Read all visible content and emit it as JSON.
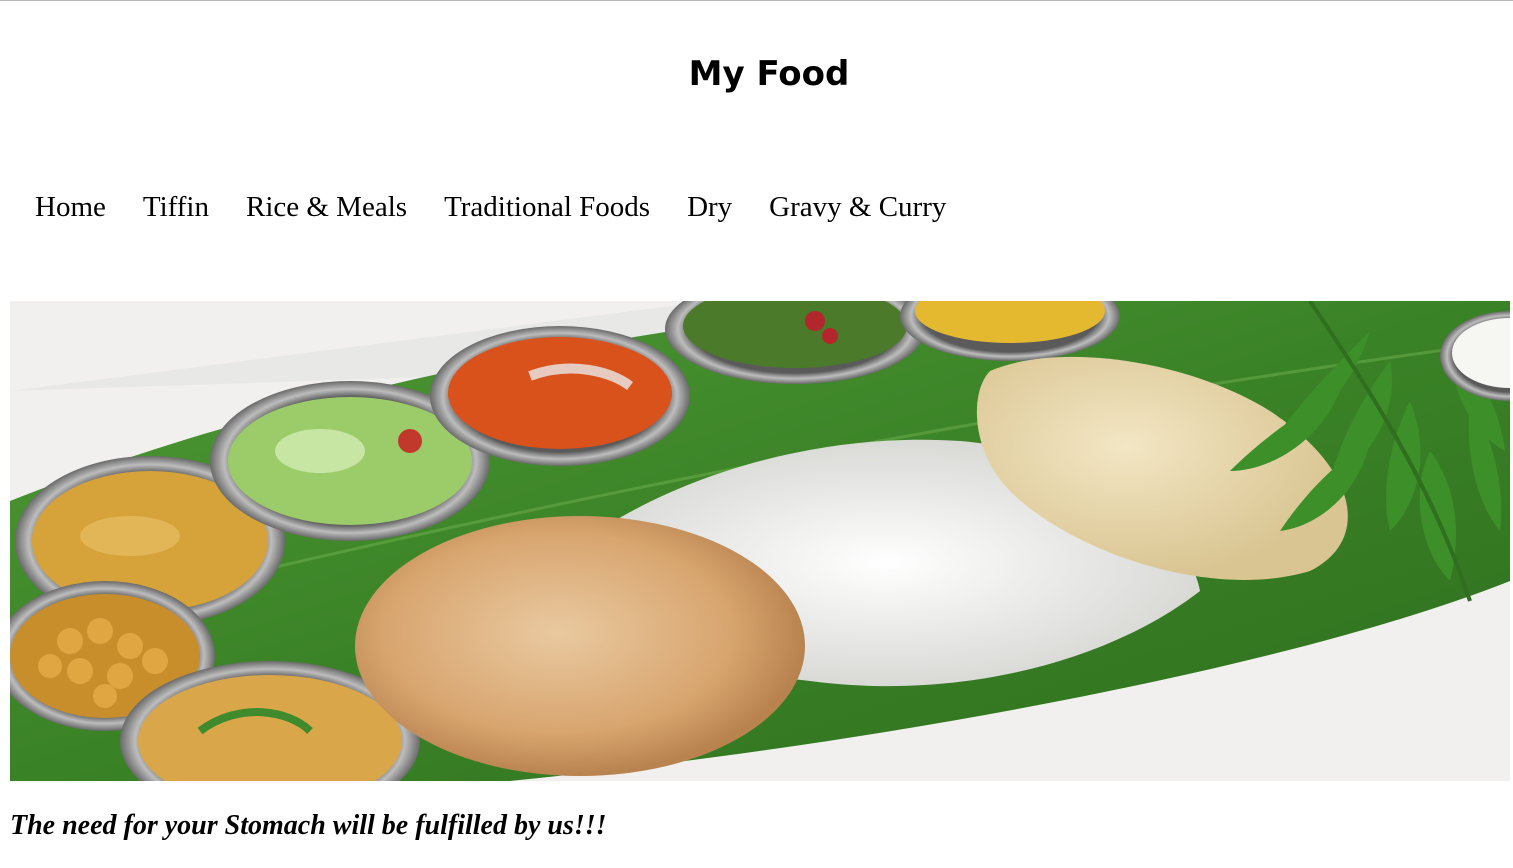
{
  "header": {
    "title": "My Food"
  },
  "nav": {
    "items": [
      {
        "label": "Home"
      },
      {
        "label": "Tiffin"
      },
      {
        "label": "Rice & Meals"
      },
      {
        "label": "Traditional Foods"
      },
      {
        "label": "Dry"
      },
      {
        "label": "Gravy & Curry"
      }
    ]
  },
  "hero": {
    "image": "south-indian-meal-on-banana-leaf"
  },
  "tagline": {
    "text": "The need for your Stomach will be fulfilled by us!!!"
  },
  "colors": {
    "text": "#000000",
    "leaf": "#3f8a2c",
    "background": "#ffffff"
  }
}
